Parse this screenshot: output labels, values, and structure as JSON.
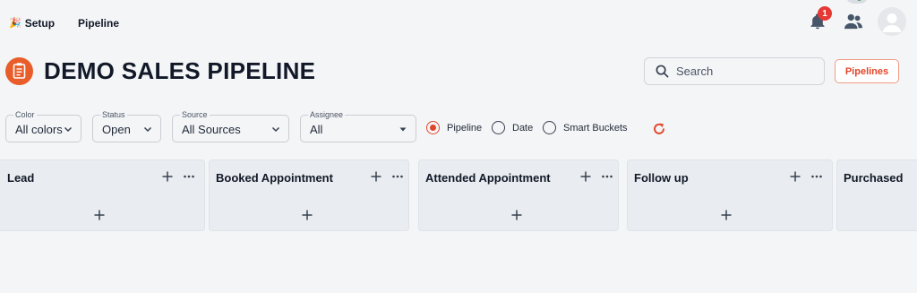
{
  "nav": {
    "setup_label": "Setup",
    "pipeline_label": "Pipeline",
    "notification_count": "1"
  },
  "header": {
    "title": "DEMO SALES PIPELINE",
    "search_placeholder": "Search",
    "pipelines_button": "Pipelines"
  },
  "filters": {
    "color": {
      "label": "Color",
      "value": "All colors"
    },
    "status": {
      "label": "Status",
      "value": "Open"
    },
    "source": {
      "label": "Source",
      "value": "All Sources"
    },
    "assignee": {
      "label": "Assignee",
      "value": "All"
    }
  },
  "view_modes": [
    {
      "label": "Pipeline",
      "checked": true
    },
    {
      "label": "Date",
      "checked": false
    },
    {
      "label": "Smart Buckets",
      "checked": false
    }
  ],
  "stages": [
    {
      "name": "Lead"
    },
    {
      "name": "Booked Appointment"
    },
    {
      "name": "Attended Appointment"
    },
    {
      "name": "Follow up"
    },
    {
      "name": "Purchased"
    }
  ],
  "colors": {
    "accent": "#e2462a",
    "badge": "#e53935",
    "online": "#43a047",
    "pipeline_icon": "#e85d2a"
  },
  "icons": [
    "party-icon",
    "bell-icon",
    "users-icon",
    "avatar-icon",
    "clipboard-icon",
    "search-icon",
    "chevron-down-icon",
    "caret-down-icon",
    "refresh-icon",
    "plus-icon",
    "more-icon"
  ]
}
